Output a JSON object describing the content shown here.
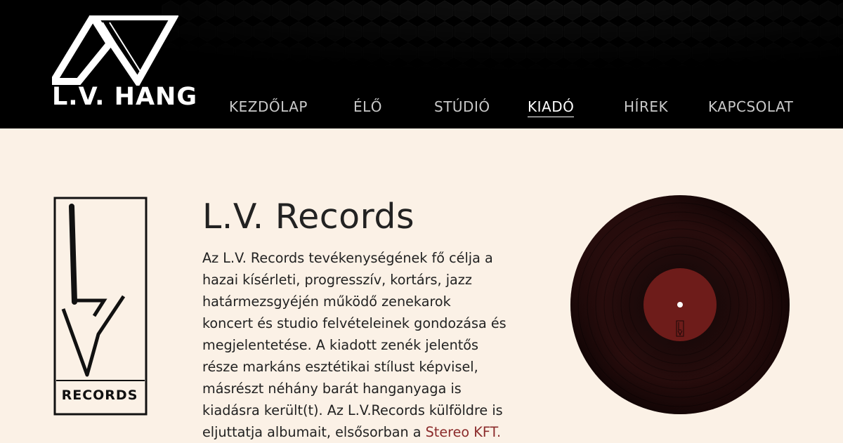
{
  "brand": {
    "name": "L.V. HANG"
  },
  "nav": [
    {
      "label": "KEZDŐLAP",
      "active": false
    },
    {
      "label": "ÉLŐ",
      "active": false
    },
    {
      "label": "STÚDIÓ",
      "active": false
    },
    {
      "label": "KIADÓ",
      "active": true
    },
    {
      "label": "HÍREK",
      "active": false
    },
    {
      "label": "KAPCSOLAT",
      "active": false
    }
  ],
  "label_logo": {
    "text": "RECORDS"
  },
  "main": {
    "title": "L.V. Records",
    "lines": [
      "Az L.V. Records tevékenységének fő célja a",
      "hazai kísérleti, progresszív, kortárs, jazz",
      "határmezsgyéjén működő zenekarok",
      "koncert és studio felvételeinek gondozása és",
      "megjelentetése. A kiadott zenék jelentős",
      "része markáns esztétikai stílust képvisel,",
      "másrészt néhány barát hanganyaga is",
      "kiadásra került(t). Az L.V.Records külföldre is"
    ],
    "last_line_prefix": "eljuttatja albumait, elsősorban a ",
    "link_label": "Stereo KFT."
  },
  "colors": {
    "header_bg": "#000000",
    "page_bg": "#fbf1e6",
    "link": "#8b2b2b",
    "vinyl_label": "#6e1c1a"
  }
}
